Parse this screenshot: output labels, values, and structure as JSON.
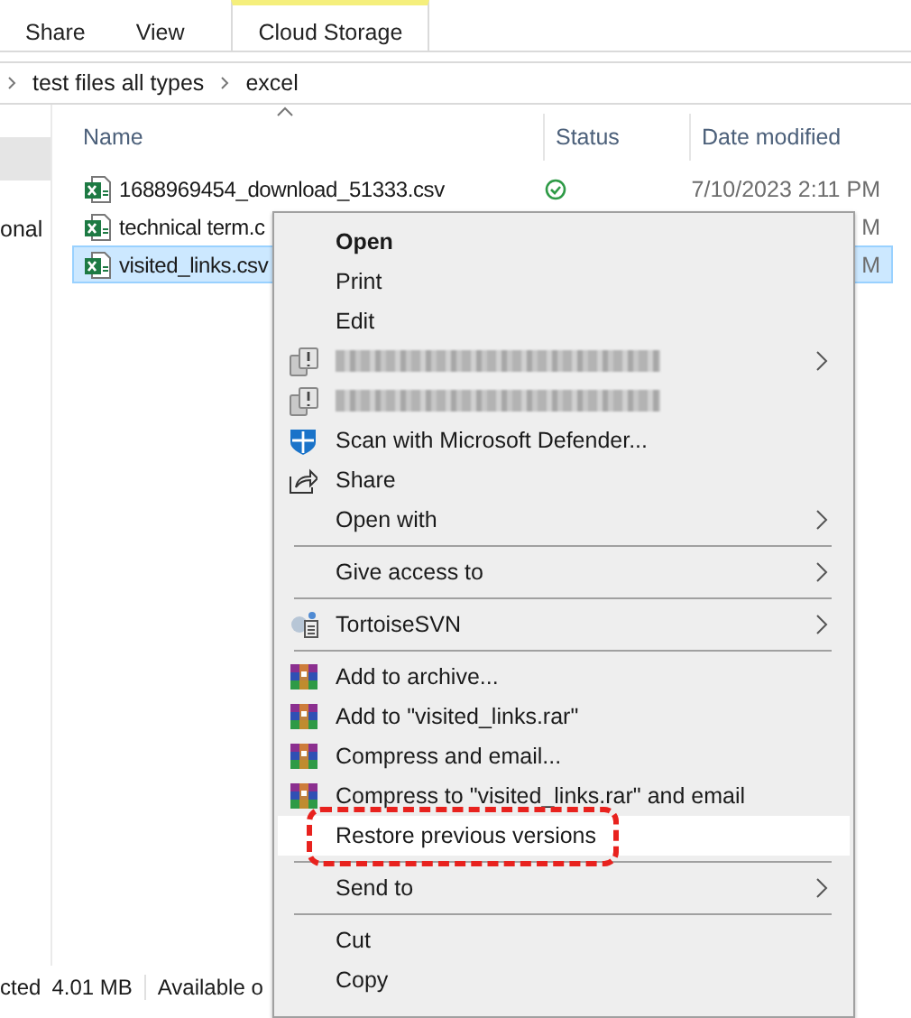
{
  "ribbon": {
    "tabs": [
      {
        "label": "Share",
        "selected": false
      },
      {
        "label": "View",
        "selected": false
      },
      {
        "label": "Cloud Storage",
        "selected": true
      }
    ]
  },
  "address_bar": {
    "path": [
      "test files all types",
      "excel"
    ]
  },
  "nav_pane": {
    "items": [
      {
        "selected": true
      },
      {
        "label": "onal",
        "selected": false
      }
    ]
  },
  "file_list": {
    "columns": [
      "Name",
      "Status",
      "Date modified"
    ],
    "rows": [
      {
        "name": "1688969454_download_51333.csv",
        "synced": true,
        "date": "7/10/2023 2:11 PM",
        "selected": false
      },
      {
        "name": "technical term.c",
        "date": "M",
        "selected": false
      },
      {
        "name": "visited_links.csv",
        "date": "M",
        "selected": true
      }
    ]
  },
  "context_menu": {
    "groups": [
      [
        {
          "kind": "text",
          "label": "Open",
          "default": true
        },
        {
          "kind": "text",
          "label": "Print"
        },
        {
          "kind": "text",
          "label": "Edit"
        },
        {
          "kind": "blurred",
          "submenu": true
        },
        {
          "kind": "blurred"
        },
        {
          "kind": "defender",
          "label": "Scan with Microsoft Defender..."
        },
        {
          "kind": "share",
          "label": "Share"
        },
        {
          "kind": "text",
          "label": "Open with",
          "submenu": true
        }
      ],
      [
        {
          "kind": "text",
          "label": "Give access to",
          "submenu": true
        }
      ],
      [
        {
          "kind": "svn",
          "label": "TortoiseSVN",
          "submenu": true
        }
      ],
      [
        {
          "kind": "archive",
          "label": "Add to archive..."
        },
        {
          "kind": "archive",
          "label": "Add to \"visited_links.rar\""
        },
        {
          "kind": "archive",
          "label": "Compress and email..."
        },
        {
          "kind": "archive",
          "label": "Compress to \"visited_links.rar\" and email"
        },
        {
          "kind": "text",
          "label": "Restore previous versions",
          "hovered": true,
          "circled": true
        }
      ],
      [
        {
          "kind": "text",
          "label": "Send to",
          "submenu": true
        }
      ],
      [
        {
          "kind": "text",
          "label": "Cut"
        },
        {
          "kind": "text",
          "label": "Copy"
        }
      ]
    ]
  },
  "status_bar": {
    "items": [
      "cted",
      "4.01 MB",
      "Available o"
    ]
  }
}
